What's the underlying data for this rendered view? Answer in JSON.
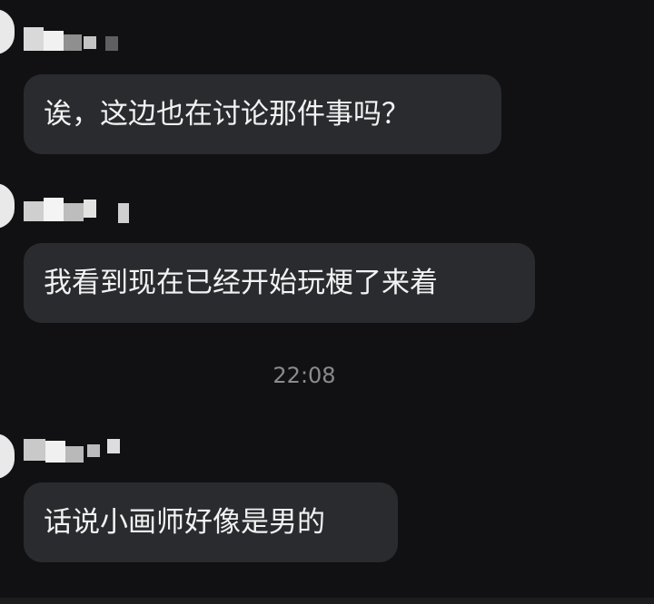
{
  "messages": [
    {
      "text": "诶，这边也在讨论那件事吗？"
    },
    {
      "text": "我看到现在已经开始玩梗了来着"
    },
    {
      "text": "话说小画师好像是男的"
    }
  ],
  "timestamp": "22:08",
  "colors": {
    "background": "#111113",
    "bubble": "#2a2b2f",
    "text": "#f2f2f2",
    "timestamp": "#8b8b8f"
  }
}
